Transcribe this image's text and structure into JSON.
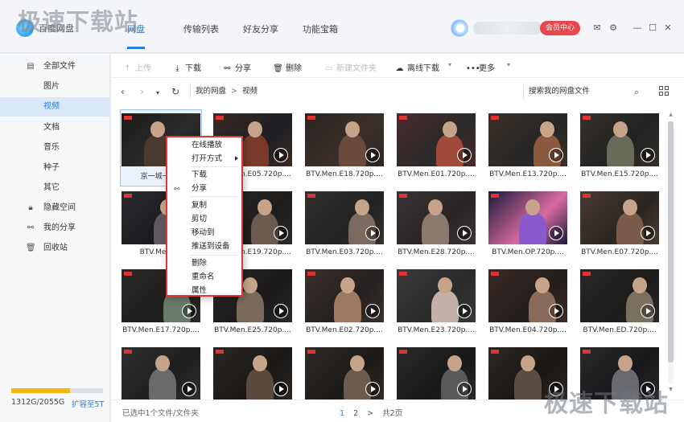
{
  "watermark": "极速下载站",
  "header": {
    "app_title": "百度网盘",
    "tabs": [
      {
        "label": "网盘",
        "active": true
      },
      {
        "label": "传输列表",
        "active": false
      },
      {
        "label": "好友分享",
        "active": false
      },
      {
        "label": "功能宝箱",
        "active": false
      }
    ],
    "vip_label": "会员中心",
    "icons": [
      "mail-icon",
      "gear-icon",
      "minimize-icon",
      "maximize-icon",
      "close-icon"
    ]
  },
  "sidebar": {
    "items": [
      {
        "label": "全部文件",
        "icon": "document-icon",
        "active": false
      },
      {
        "label": "图片",
        "active": false
      },
      {
        "label": "视频",
        "active": true
      },
      {
        "label": "文档",
        "active": false
      },
      {
        "label": "音乐",
        "active": false
      },
      {
        "label": "种子",
        "active": false
      },
      {
        "label": "其它",
        "active": false
      },
      {
        "label": "隐藏空间",
        "icon": "lock-icon",
        "active": false
      },
      {
        "label": "我的分享",
        "icon": "share-icon",
        "active": false
      },
      {
        "label": "回收站",
        "icon": "trash-icon",
        "active": false
      }
    ],
    "quota": {
      "used": "1312G/2055G",
      "fraction": 0.638,
      "expand_label": "扩容至5T"
    }
  },
  "toolbar": {
    "upload": "上传",
    "download": "下载",
    "share": "分享",
    "delete": "删除",
    "new_folder": "新建文件夹",
    "offline_download": "离线下载",
    "more": "更多"
  },
  "pathbar": {
    "crumbs": [
      "我的网盘",
      "视频"
    ],
    "search_placeholder": "搜索我的网盘文件"
  },
  "files": [
    {
      "name": "京一城一81-",
      "selected": true
    },
    {
      "name": "BTV.Men.E05.720p...."
    },
    {
      "name": "BTV.Men.E18.720p...."
    },
    {
      "name": "BTV.Men.E01.720p...."
    },
    {
      "name": "BTV.Men.E13.720p...."
    },
    {
      "name": "BTV.Men.E15.720p...."
    },
    {
      "name": "BTV.Men.E1"
    },
    {
      "name": "BTV.Men.E19.720p...."
    },
    {
      "name": "BTV.Men.E03.720p...."
    },
    {
      "name": "BTV.Men.E28.720p...."
    },
    {
      "name": "BTV.Men.OP.720p...."
    },
    {
      "name": "BTV.Men.E07.720p...."
    },
    {
      "name": "BTV.Men.E17.720p...."
    },
    {
      "name": "BTV.Men.E25.720p...."
    },
    {
      "name": "BTV.Men.E02.720p...."
    },
    {
      "name": "BTV.Men.E23.720p...."
    },
    {
      "name": "BTV.Men.E04.720p...."
    },
    {
      "name": "BTV.Men.ED.720p...."
    },
    {
      "name": ""
    },
    {
      "name": ""
    },
    {
      "name": ""
    },
    {
      "name": ""
    },
    {
      "name": ""
    },
    {
      "name": ""
    }
  ],
  "context_menu": {
    "items": [
      "在线播放",
      "打开方式",
      "下载",
      "分享",
      "复制",
      "剪切",
      "移动到",
      "推送到设备",
      "删除",
      "重命名",
      "属性"
    ]
  },
  "status": {
    "selection_text": "已选中1个文件/文件夹",
    "pages": [
      "1",
      "2"
    ],
    "next": ">",
    "total": "共2页"
  }
}
